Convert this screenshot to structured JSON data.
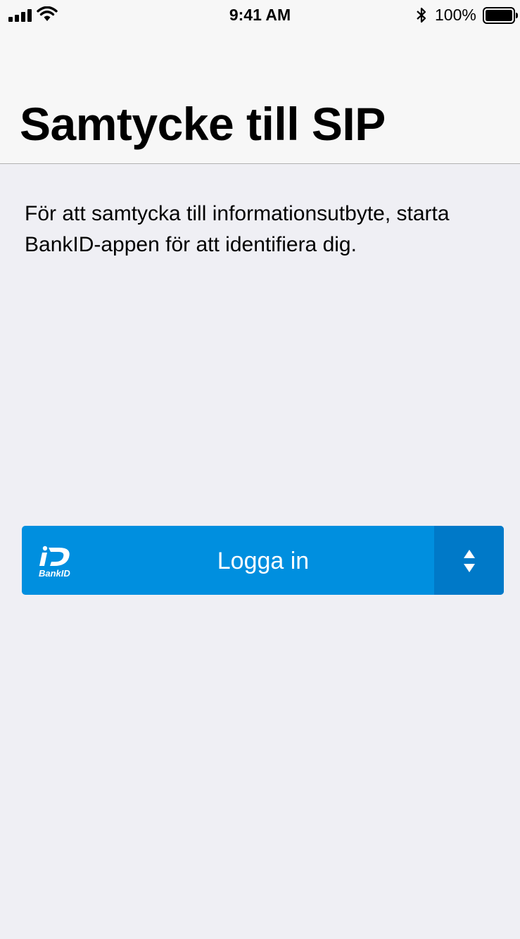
{
  "status_bar": {
    "time": "9:41 AM",
    "battery_percent": "100%",
    "signal_bars": 4,
    "wifi_icon": "wifi-icon",
    "bluetooth_icon": "bluetooth-icon",
    "battery_level": 1.0
  },
  "header": {
    "title": "Samtycke till SIP"
  },
  "main": {
    "description": "För att samtycka till informationsutbyte, starta BankID-appen för att identifiera dig."
  },
  "login_button": {
    "label": "Logga in",
    "logo_text": "BankID",
    "switch_icon": "up-down-arrows-icon",
    "background_color": "#008fdf",
    "switch_background_color": "#0079c8"
  },
  "colors": {
    "page_background": "#efeff4",
    "header_background": "#f7f7f7"
  }
}
